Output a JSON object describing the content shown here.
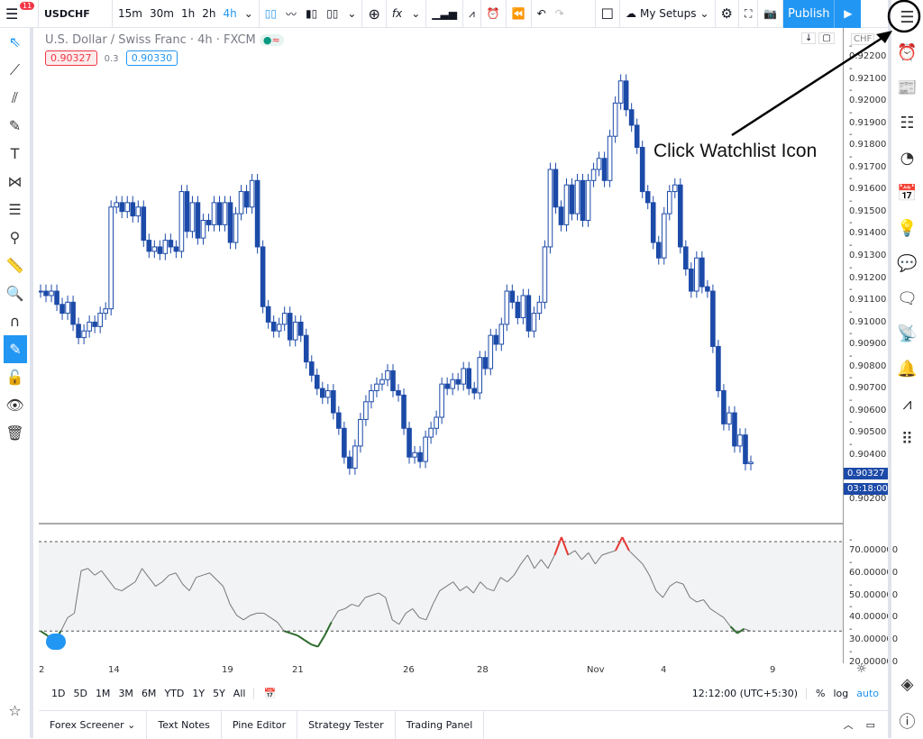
{
  "header": {
    "menu_badge": "11",
    "symbol": "USDCHF",
    "intervals": [
      "15m",
      "30m",
      "1h",
      "2h",
      "4h"
    ],
    "active_interval": "4h",
    "my_setups": "My Setups",
    "publish": "Publish"
  },
  "legend": {
    "title": "U.S. Dollar / Swiss Franc · 4h · FXCM",
    "bid": "0.90327",
    "spread": "0.3",
    "ask": "0.90330",
    "currency": "CHF"
  },
  "price_axis": {
    "labels": [
      "0.92200",
      "0.92100",
      "0.92000",
      "0.91900",
      "0.91800",
      "0.91700",
      "0.91600",
      "0.91500",
      "0.91400",
      "0.91300",
      "0.91200",
      "0.91100",
      "0.91000",
      "0.90900",
      "0.90800",
      "0.90700",
      "0.90600",
      "0.90500",
      "0.90400",
      "0.90200"
    ],
    "last_price": "0.90327",
    "countdown": "03:18:00"
  },
  "indicator_axis": {
    "labels": [
      "70.000000",
      "60.000000",
      "50.000000",
      "40.000000",
      "30.000000",
      "20.000000"
    ]
  },
  "time_axis": [
    "2",
    "14",
    "19",
    "21",
    "26",
    "28",
    "Nov",
    "4",
    "9"
  ],
  "range_bar": {
    "ranges": [
      "1D",
      "5D",
      "1M",
      "3M",
      "6M",
      "YTD",
      "1Y",
      "5Y",
      "All"
    ],
    "time": "12:12:00 (UTC+5:30)",
    "percent": "%",
    "log": "log",
    "auto": "auto"
  },
  "bottom_tabs": [
    "Forex Screener",
    "Text Notes",
    "Pine Editor",
    "Strategy Tester",
    "Trading Panel"
  ],
  "annotation": "Click Watchlist Icon",
  "colors": {
    "accent": "#2196f3",
    "candle": "#1c4aa8",
    "overbought": "#e53935",
    "oversold": "#2e6b2e"
  },
  "chart_data": {
    "type": "candlestick",
    "ylim": [
      0.9016,
      0.9224
    ],
    "close": [
      0.911,
      0.9108,
      0.911,
      0.9104,
      0.91,
      0.9105,
      0.9095,
      0.9089,
      0.9092,
      0.9096,
      0.9094,
      0.91,
      0.9102,
      0.9148,
      0.915,
      0.9146,
      0.915,
      0.9144,
      0.9148,
      0.9133,
      0.9128,
      0.913,
      0.9127,
      0.9133,
      0.913,
      0.9128,
      0.9155,
      0.9137,
      0.915,
      0.9134,
      0.9142,
      0.914,
      0.915,
      0.914,
      0.915,
      0.9132,
      0.9145,
      0.9155,
      0.9148,
      0.916,
      0.913,
      0.9103,
      0.9096,
      0.9092,
      0.9095,
      0.91,
      0.9088,
      0.9096,
      0.909,
      0.9078,
      0.9072,
      0.9066,
      0.9062,
      0.9065,
      0.9055,
      0.9048,
      0.9035,
      0.903,
      0.904,
      0.9052,
      0.906,
      0.9065,
      0.9068,
      0.907,
      0.9074,
      0.9065,
      0.9063,
      0.9048,
      0.9035,
      0.9037,
      0.9033,
      0.9044,
      0.9048,
      0.9053,
      0.9068,
      0.9066,
      0.907,
      0.9068,
      0.9075,
      0.9066,
      0.9064,
      0.908,
      0.9075,
      0.909,
      0.9086,
      0.9095,
      0.911,
      0.9105,
      0.9098,
      0.9108,
      0.9092,
      0.91,
      0.9105,
      0.913,
      0.9165,
      0.9148,
      0.914,
      0.9158,
      0.9145,
      0.916,
      0.9142,
      0.916,
      0.9165,
      0.917,
      0.916,
      0.918,
      0.9195,
      0.9205,
      0.9192,
      0.9185,
      0.9175,
      0.9155,
      0.915,
      0.9132,
      0.9125,
      0.9145,
      0.9155,
      0.9158,
      0.913,
      0.912,
      0.911,
      0.9125,
      0.9112,
      0.911,
      0.9085,
      0.9065,
      0.905,
      0.9055,
      0.904,
      0.9045,
      0.9032,
      0.90327
    ],
    "indicator": {
      "ylim": [
        18,
        76
      ],
      "levels": [
        30,
        70
      ],
      "values": [
        30,
        28,
        25,
        30,
        36,
        38,
        57,
        58,
        55,
        57,
        53,
        49,
        48,
        50,
        52,
        58,
        54,
        50,
        52,
        55,
        56,
        51,
        48,
        54,
        55,
        56,
        53,
        50,
        42,
        37,
        35,
        37,
        38,
        38,
        36,
        34,
        30,
        29,
        28,
        26,
        24,
        23,
        28,
        34,
        39,
        40,
        42,
        41,
        45,
        46,
        47,
        45,
        35,
        33,
        38,
        40,
        36,
        35,
        42,
        48,
        50,
        52,
        48,
        50,
        47,
        52,
        49,
        48,
        54,
        52,
        55,
        60,
        64,
        58,
        62,
        58,
        64,
        72,
        64,
        66,
        62,
        65,
        60,
        64,
        65,
        66,
        72,
        66,
        63,
        60,
        55,
        48,
        45,
        50,
        52,
        51,
        45,
        43,
        44,
        40,
        38,
        36,
        32,
        29,
        31,
        30
      ]
    }
  }
}
